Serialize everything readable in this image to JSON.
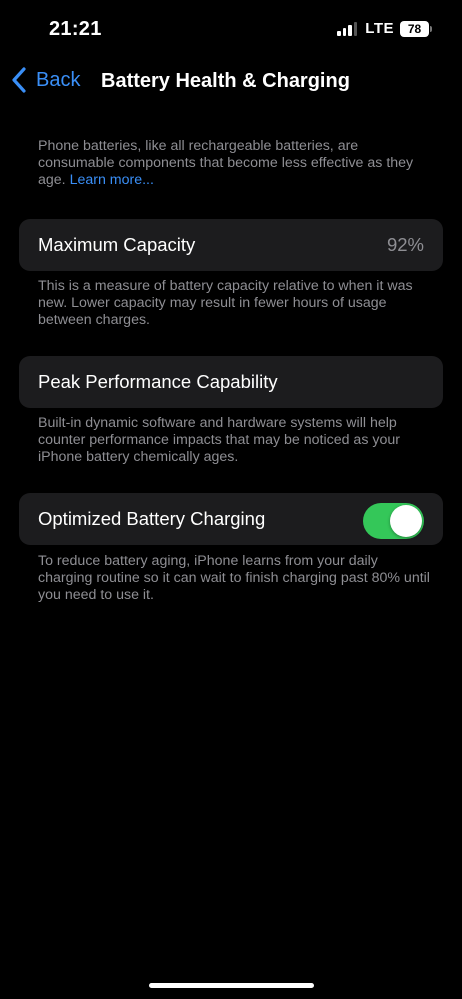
{
  "status_bar": {
    "time": "21:21",
    "network": "LTE",
    "battery_level": "78"
  },
  "nav": {
    "back_label": "Back",
    "title": "Battery Health & Charging"
  },
  "intro": {
    "text": "Phone batteries, like all rechargeable batteries, are consumable components that become less effective as they age. ",
    "link": "Learn more..."
  },
  "max_capacity": {
    "label": "Maximum Capacity",
    "value": "92%",
    "description": "This is a measure of battery capacity relative to when it was new. Lower capacity may result in fewer hours of usage between charges."
  },
  "peak_performance": {
    "label": "Peak Performance Capability",
    "description": "Built-in dynamic software and hardware systems will help counter performance impacts that may be noticed as your iPhone battery chemically ages."
  },
  "optimized_charging": {
    "label": "Optimized Battery Charging",
    "enabled": true,
    "toggle_color": "#34c759",
    "description": "To reduce battery aging, iPhone learns from your daily charging routine so it can wait to finish charging past 80% until you need to use it."
  },
  "colors": {
    "accent": "#3a8ff7",
    "cell_background": "#1c1c1e",
    "secondary_text": "#8e8e93"
  },
  "icons": {
    "back": "chevron-left-icon",
    "signal": "cellular-signal-icon",
    "battery": "battery-icon"
  }
}
